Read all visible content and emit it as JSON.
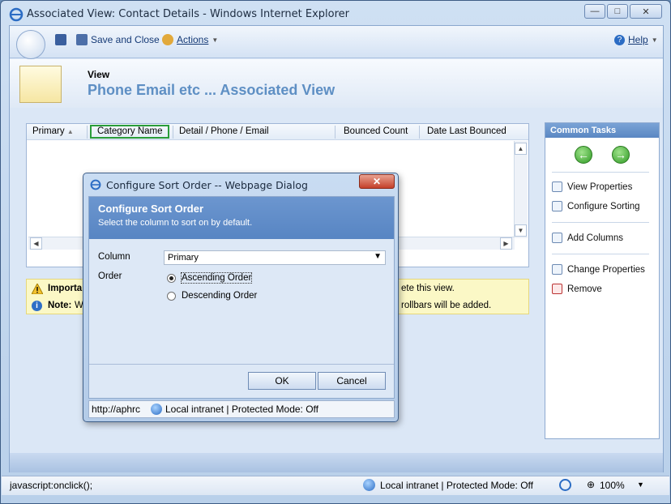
{
  "window": {
    "title": "Associated View: Contact Details - Windows Internet Explorer"
  },
  "toolbar": {
    "save_close": "Save and Close",
    "actions": "Actions",
    "help": "Help"
  },
  "header": {
    "label": "View",
    "title": "Phone Email etc ... Associated View"
  },
  "grid": {
    "columns": [
      "Primary",
      "Category Name",
      "Detail / Phone / Email",
      "Bounced Count",
      "Date Last Bounced"
    ]
  },
  "notice": {
    "important_label": "Importa",
    "important_tail": "ete this view.",
    "note_label": "Note:",
    "note_prefix": "Wh",
    "note_tail": "rollbars will be added."
  },
  "tasks": {
    "title": "Common Tasks",
    "items": [
      "View Properties",
      "Configure Sorting",
      "Add Columns",
      "Change Properties",
      "Remove"
    ]
  },
  "statusbar": {
    "left": "javascript:onclick();",
    "zone": "Local intranet | Protected Mode: Off",
    "zoom": "100%"
  },
  "dialog": {
    "title": "Configure Sort Order -- Webpage Dialog",
    "heading": "Configure Sort Order",
    "subheading": "Select the column to sort on by default.",
    "column_label": "Column",
    "column_value": "Primary",
    "order_label": "Order",
    "ascending": "Ascending Order",
    "descending": "Descending Order",
    "ok": "OK",
    "cancel": "Cancel",
    "status_url": "http://aphrc",
    "status_zone": "Local intranet | Protected Mode: Off"
  },
  "colors": {
    "accent": "#5e8fc4",
    "sorted_outline": "#2a9d3a",
    "notice_bg": "#fbf8c6"
  }
}
